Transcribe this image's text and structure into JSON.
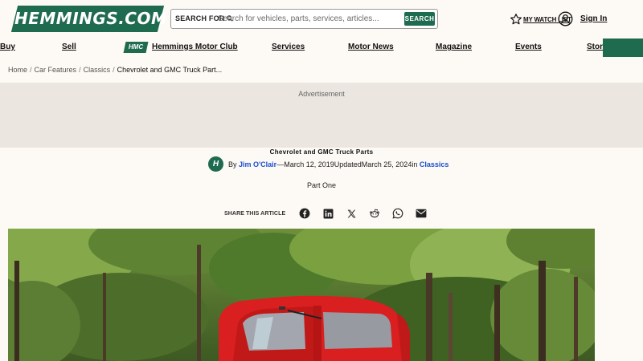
{
  "header": {
    "logo_text": "HEMMINGS.COM",
    "search_label": "SEARCH FOR",
    "search_placeholder": "Search for vehicles, parts, services, articles...",
    "search_button": "SEARCH",
    "watch_list": "MY WATCH LIST",
    "sign_in": "Sign In"
  },
  "nav": {
    "buy": "Buy",
    "sell": "Sell",
    "hmc_badge": "HMC",
    "motor_club": "Hemmings Motor Club",
    "services": "Services",
    "motor_news": "Motor News",
    "magazine": "Magazine",
    "events": "Events",
    "store": "Store"
  },
  "breadcrumb": {
    "items": [
      "Home",
      "Car Features",
      "Classics"
    ],
    "current": "Chevrolet and GMC Truck Part..."
  },
  "ad": {
    "label": "Advertisement"
  },
  "article": {
    "title": "Chevrolet and GMC Truck Parts",
    "avatar_letter": "H",
    "by": "By",
    "author": "Jim O'Clair",
    "published_sep": "—",
    "published": "March 12, 2019",
    "updated_label": "Updated",
    "updated": "March 25, 2024",
    "in_label": "in",
    "category": "Classics",
    "subtitle": "Part One"
  },
  "share": {
    "label": "SHARE THIS ARTICLE",
    "icons": [
      "facebook-icon",
      "linkedin-icon",
      "x-icon",
      "reddit-icon",
      "whatsapp-icon",
      "email-icon"
    ]
  },
  "colors": {
    "brand_green": "#1f6b50",
    "link_blue": "#1a4fd1",
    "page_bg": "#fdf9f4",
    "ad_bg": "#ebe6df"
  }
}
